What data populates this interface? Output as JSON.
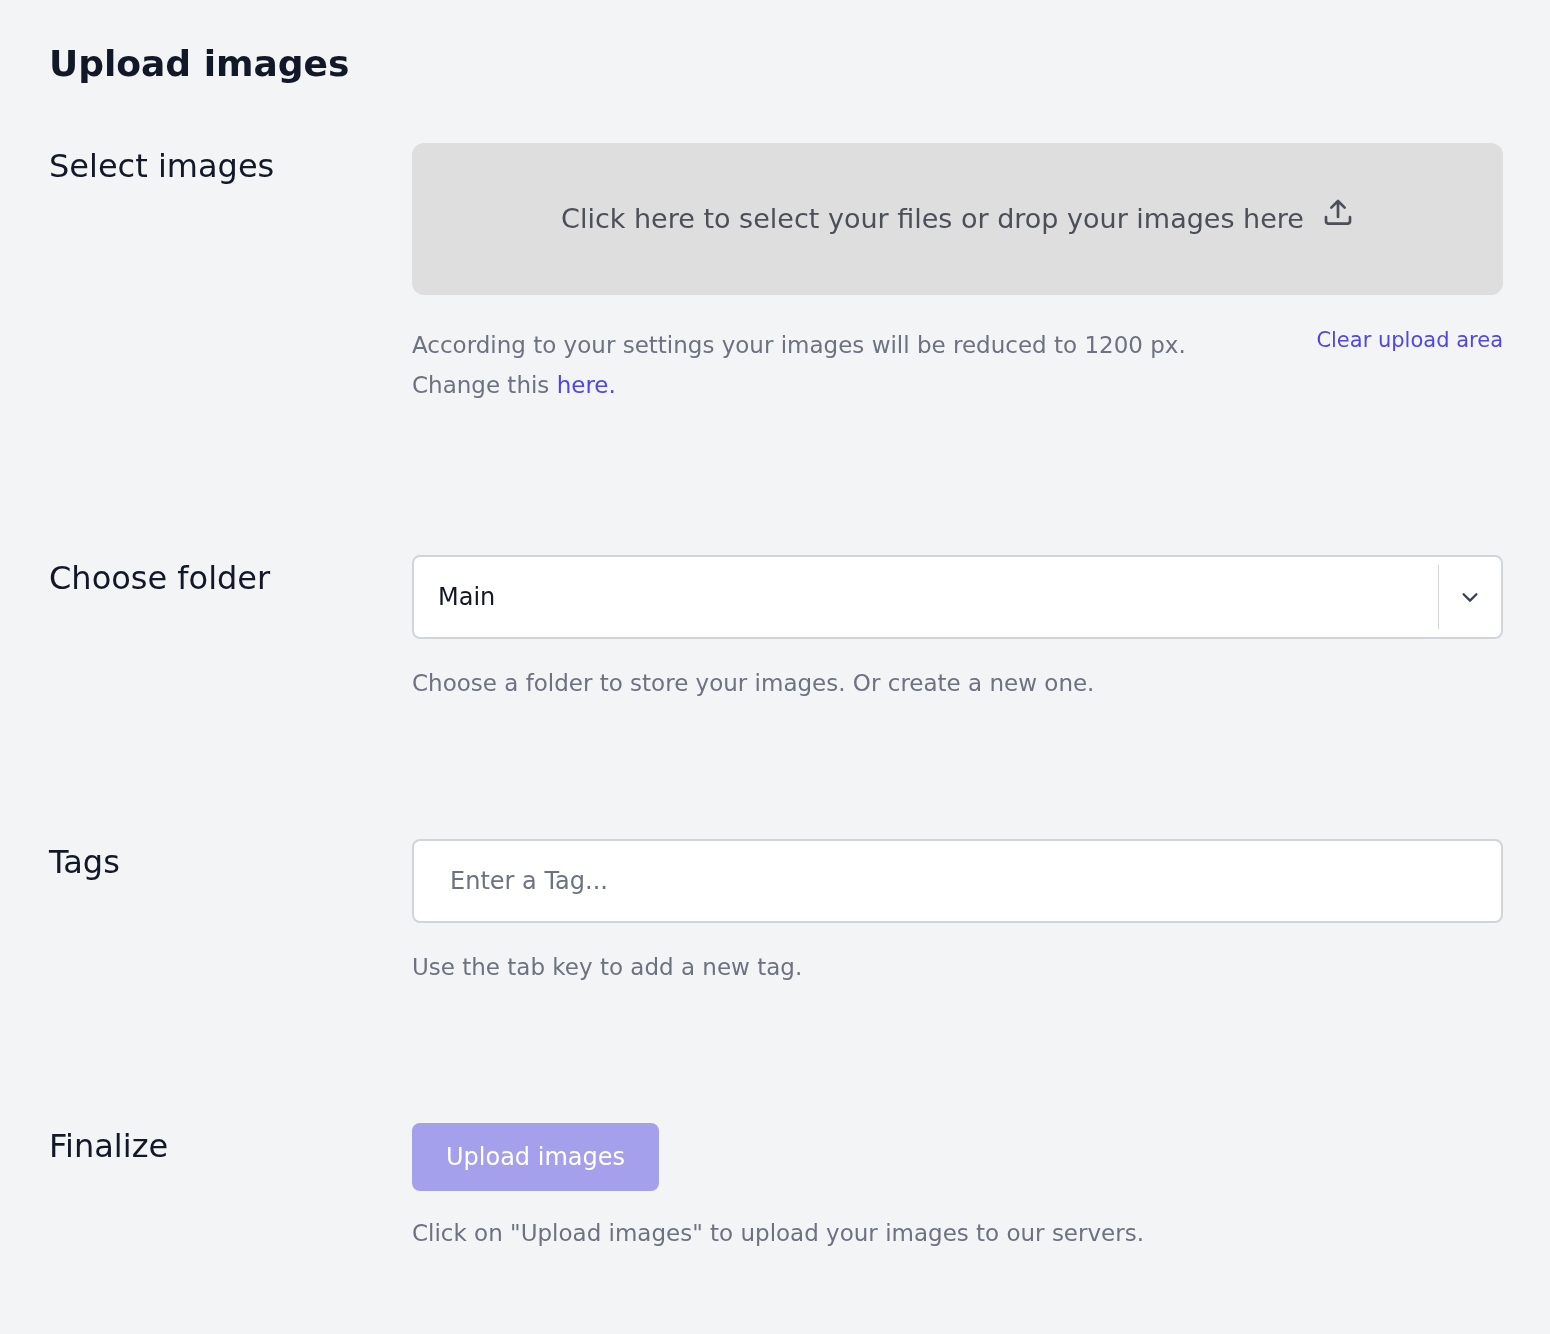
{
  "title": "Upload images",
  "sections": [
    {
      "kind": "dropzone",
      "label": "Select images",
      "dropzone_text": "Click here to select your files or drop your images here",
      "help": "According to your settings your images will be reduced to 1200 px. Change this ",
      "help_link": "here.",
      "side_link": "Clear upload area"
    },
    {
      "kind": "select",
      "label": "Choose folder",
      "value": "Main",
      "help": "Choose a folder to store your images. Or create a new one."
    },
    {
      "kind": "text",
      "label": "Tags",
      "placeholder": "Enter a Tag...",
      "help": "Use the tab key to add a new tag."
    },
    {
      "kind": "button",
      "label": "Finalize",
      "button": "Upload images",
      "disabled": true,
      "help": "Click on \"Upload images\" to upload your images to our servers."
    }
  ]
}
